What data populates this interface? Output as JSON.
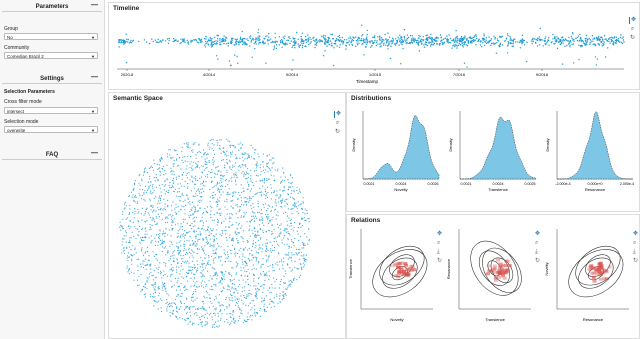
{
  "sidebar": {
    "parameters_title": "Parameters",
    "group_label": "Group",
    "group_value": "No",
    "community_label": "Community",
    "community_value": "Comedian Brazil 2",
    "settings_title": "Settings",
    "selection_parameters_label": "Selection Parameters",
    "cross_filter_label": "Cross filter mode",
    "cross_filter_value": "intersect",
    "selection_mode_label": "Selection mode",
    "selection_mode_value": "overwrite",
    "faq_title": "FAQ",
    "toggle_minus": "—"
  },
  "timeline": {
    "title": "Timeline",
    "xlabel": "Timestamp",
    "ticks": [
      "2020-8",
      "4/2014",
      "9/2014",
      "1/2015",
      "7/2016",
      "9/2016"
    ]
  },
  "semantic": {
    "title": "Semantic Space"
  },
  "distributions": {
    "title": "Distributions",
    "plots": [
      {
        "xlabel": "Novelty",
        "ylabel": "Density",
        "xticks": [
          "0.0021",
          "0.0024",
          "0.0026"
        ]
      },
      {
        "xlabel": "Transience",
        "ylabel": "Density",
        "xticks": [
          "0.0021",
          "0.0024",
          "0.0025"
        ]
      },
      {
        "xlabel": "Resonance",
        "ylabel": "Density",
        "xticks": [
          "-2.000e-4",
          "0.000e+0",
          "2.000e-4"
        ]
      }
    ]
  },
  "relations": {
    "title": "Relations",
    "plots": [
      {
        "xlabel": "Novelty",
        "ylabel": "Transience"
      },
      {
        "xlabel": "Transience",
        "ylabel": "Resonance"
      },
      {
        "xlabel": "Resonance",
        "ylabel": "Novelty"
      }
    ]
  },
  "colors": {
    "accent": "#1f9bd6",
    "contour": "#333333",
    "heat": "#d9534f"
  },
  "icons": [
    "pan-icon",
    "zoom-icon",
    "reset-icon",
    "save-icon"
  ]
}
